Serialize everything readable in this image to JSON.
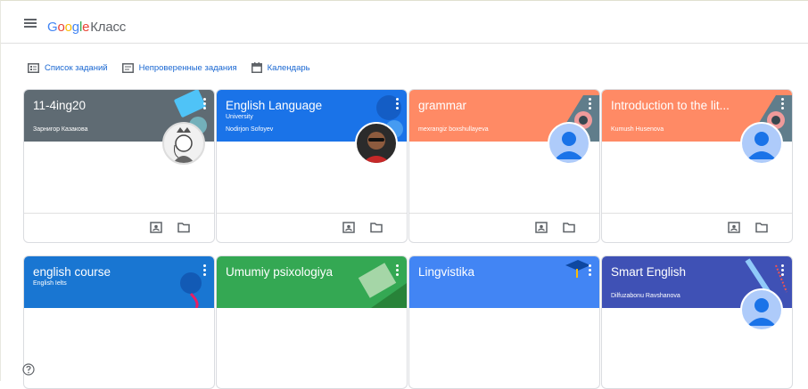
{
  "header": {
    "logo_google": "Google",
    "logo_product": "Класс"
  },
  "toolbar": {
    "todo": "Список заданий",
    "review": "Непроверенные задания",
    "calendar": "Календарь"
  },
  "classes": [
    {
      "title": "11-4ing20",
      "section": "",
      "teacher": "Зарнигор Казакова",
      "color": "#5f6b73"
    },
    {
      "title": "English Language",
      "section": "University",
      "teacher": "Nodirjon Sofoyev",
      "color": "#1a73e8"
    },
    {
      "title": "grammar",
      "section": "",
      "teacher": "mexrangiz boxshullayeva",
      "color": "#ff8a65"
    },
    {
      "title": "Introduction to the lit...",
      "section": "",
      "teacher": "Kumush Husenova",
      "color": "#ff8a65"
    },
    {
      "title": "english course",
      "section": "English Ielts",
      "teacher": "",
      "color": "#1976d2"
    },
    {
      "title": "Umumiy psixologiya",
      "section": "",
      "teacher": "",
      "color": "#34a853"
    },
    {
      "title": "Lingvistika",
      "section": "",
      "teacher": "",
      "color": "#4285f4"
    },
    {
      "title": "Smart English",
      "section": "",
      "teacher": "Dilfuzabonu Ravshanova",
      "color": "#3f51b5"
    }
  ],
  "icons": {
    "menu": "hamburger-icon",
    "todo": "assignment-list-icon",
    "review": "review-icon",
    "calendar": "calendar-icon",
    "gradebook": "assignment-ind-icon",
    "folder": "folder-icon",
    "more": "more-vert-icon",
    "help": "help-icon"
  }
}
